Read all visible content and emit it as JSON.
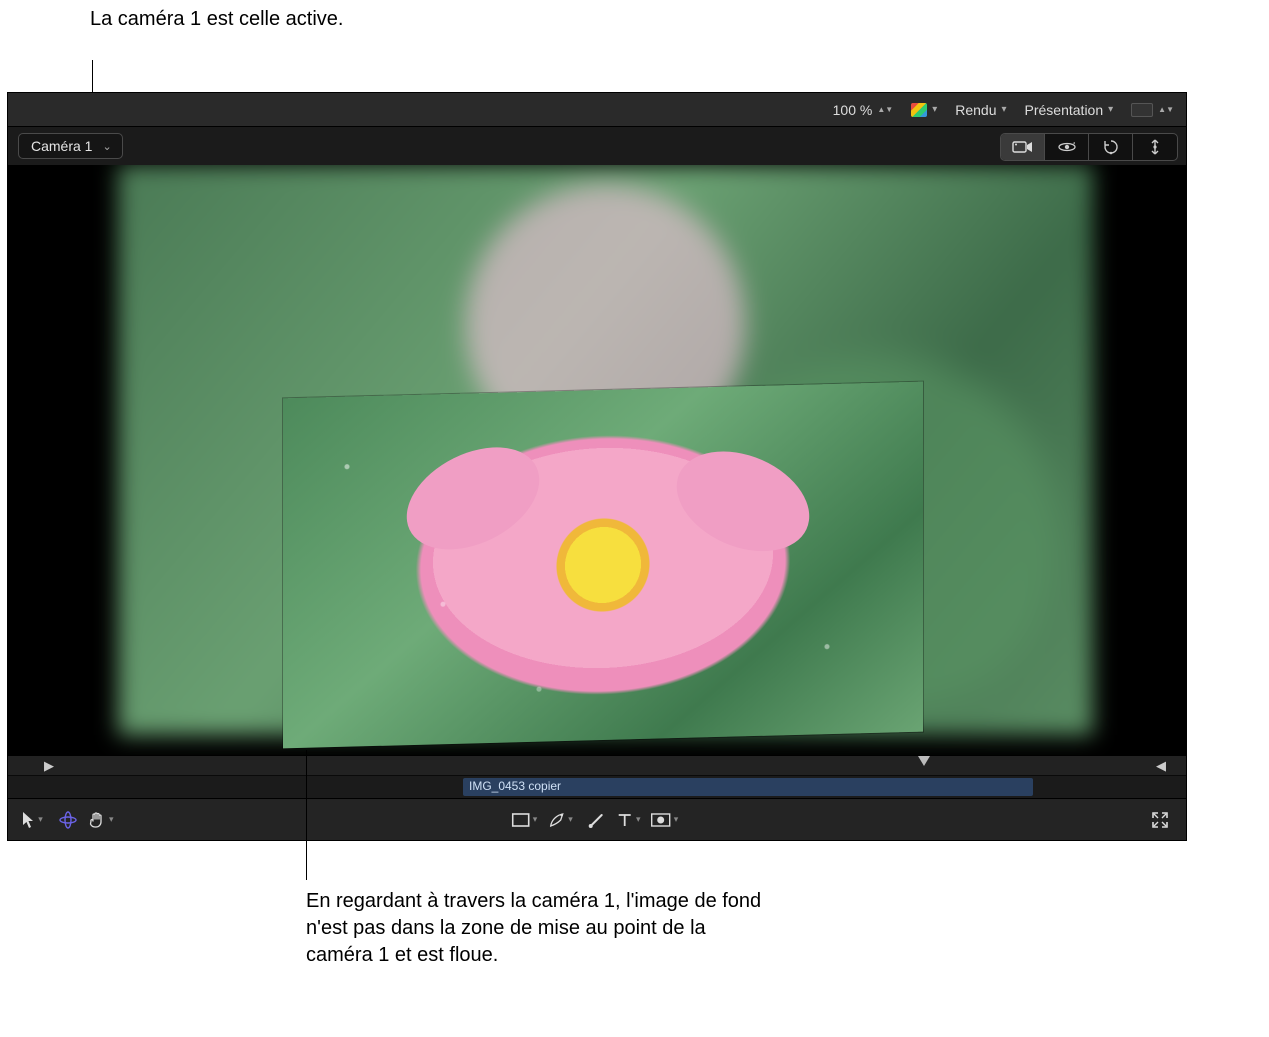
{
  "annotations": {
    "top": "La caméra 1 est celle active.",
    "bottom": "En regardant à travers la caméra 1, l'image de fond n'est pas dans la zone de mise au point de la caméra 1 et est floue."
  },
  "topbar": {
    "zoom_label": "100 %",
    "render_label": "Rendu",
    "presentation_label": "Présentation"
  },
  "camera": {
    "selected": "Caméra 1"
  },
  "timeline": {
    "clip_name": "IMG_0453 copier"
  },
  "icons": {
    "color_channels": "color-channels-icon",
    "bg_color": "background-color-icon",
    "camera": "camera-icon",
    "orbit": "orbit-icon",
    "rotate": "rotate-icon",
    "axis": "axis-icon",
    "arrow": "arrow-tool-icon",
    "transform3d": "3d-transform-icon",
    "hand": "hand-tool-icon",
    "rect": "rectangle-tool-icon",
    "pen": "pen-tool-icon",
    "brush": "brush-tool-icon",
    "text": "text-tool-icon",
    "mask": "mask-tool-icon",
    "expand": "expand-icon",
    "in_mark": "in-point-icon",
    "out_mark": "out-point-icon"
  }
}
